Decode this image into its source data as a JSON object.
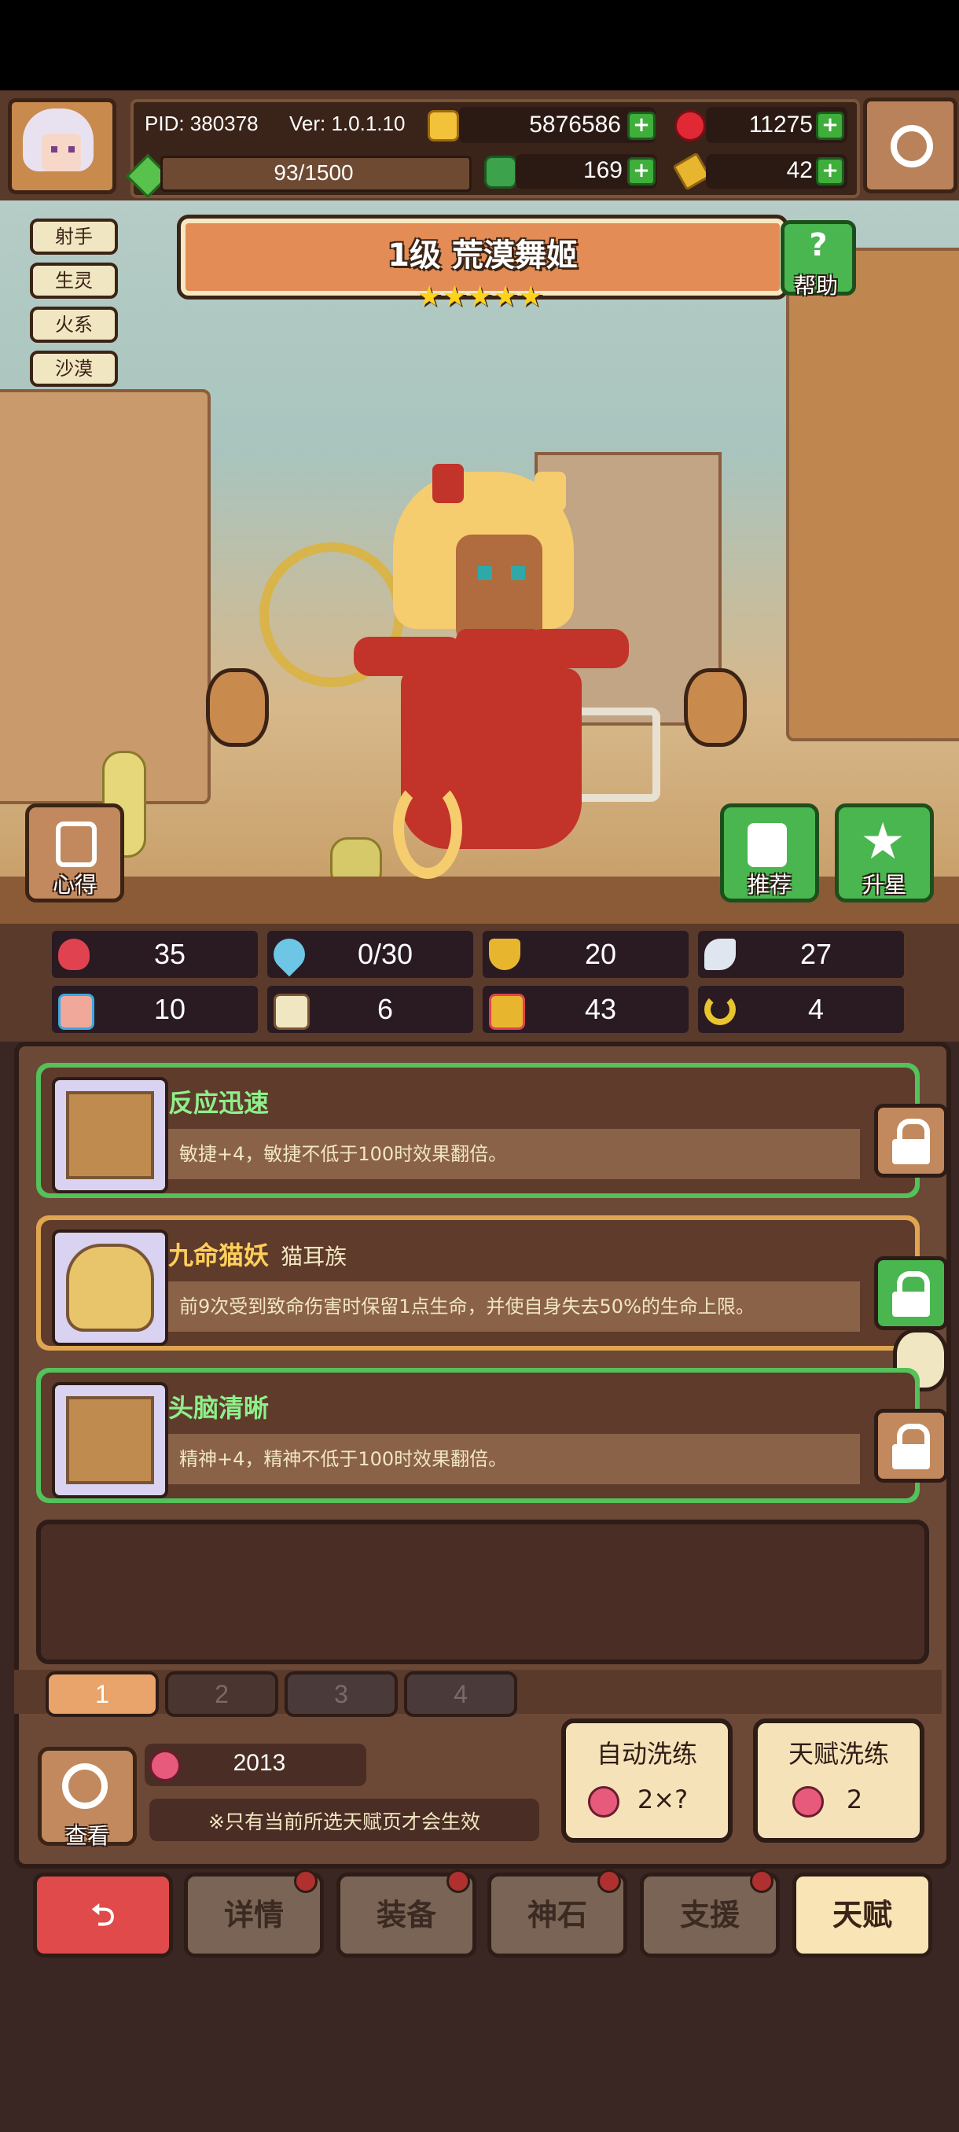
{
  "header": {
    "pid": "PID: 380378",
    "version": "Ver: 1.0.1.10",
    "gold": "5876586",
    "ruby": "11275",
    "xp": "93/1500",
    "clover": "169",
    "keys": "42"
  },
  "hero": {
    "tags": [
      "射手",
      "生灵",
      "火系",
      "沙漠"
    ],
    "title": "1级  荒漠舞姬",
    "stars": "★★★★★",
    "star_count": 5
  },
  "buttons": {
    "help": "帮助",
    "notes": "心得",
    "recommend": "推荐",
    "star_up": "升星",
    "view": "查看",
    "auto_reroll": "自动洗练",
    "auto_reroll_cost": "2×?",
    "talent_reroll": "天赋洗练",
    "talent_reroll_cost": "2"
  },
  "stats": [
    {
      "icon": "heart-icon",
      "value": "35"
    },
    {
      "icon": "water-drop-icon",
      "value": "0/30"
    },
    {
      "icon": "shield-icon",
      "value": "20"
    },
    {
      "icon": "wing-icon",
      "value": "27"
    },
    {
      "icon": "fist-icon",
      "value": "10"
    },
    {
      "icon": "book-icon",
      "value": "6"
    },
    {
      "icon": "boot-icon",
      "value": "43"
    },
    {
      "icon": "horseshoe-icon",
      "value": "4"
    }
  ],
  "talents": [
    {
      "name": "反应迅速",
      "sub": "",
      "desc": "敏捷+4，敏捷不低于100时效果翻倍。",
      "locked": false,
      "frame": "green"
    },
    {
      "name": "九命猫妖",
      "sub": "猫耳族",
      "desc": "前9次受到致命伤害时保留1点生命，并使自身失去50%的生命上限。",
      "locked": true,
      "frame": "gold"
    },
    {
      "name": "头脑清晰",
      "sub": "",
      "desc": "精神+4，精神不低于100时效果翻倍。",
      "locked": false,
      "frame": "green"
    }
  ],
  "pages": [
    "1",
    "2",
    "3",
    "4"
  ],
  "active_page": "1",
  "peach_count": "2013",
  "notice": "※只有当前所选天赋页才会生效",
  "nav": [
    "详情",
    "装备",
    "神石",
    "支援",
    "天赋"
  ],
  "colors": {
    "accent_green": "#54c15b",
    "accent_gold": "#e0a550",
    "panel_brown": "#6c4836",
    "back_red": "#e04a4a"
  }
}
